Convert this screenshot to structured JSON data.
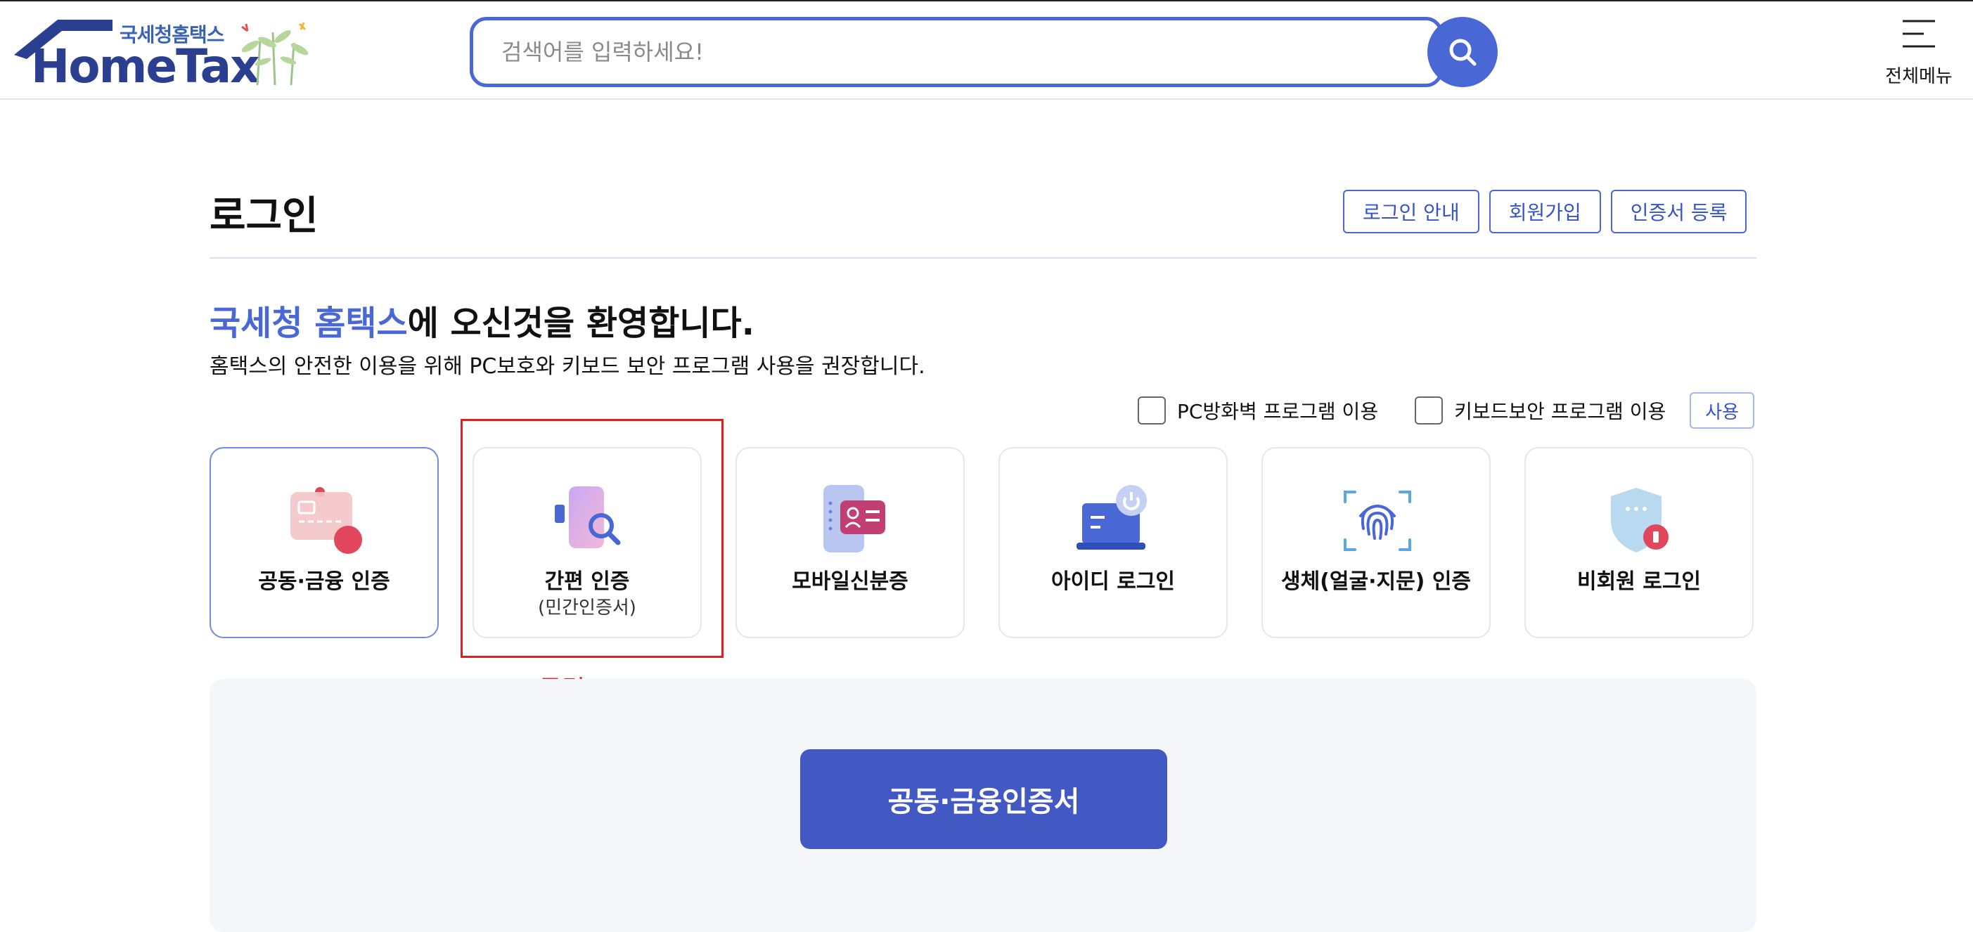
{
  "header": {
    "logo": {
      "subtitle": "국세청홈택스",
      "title": "HomeTax"
    },
    "search": {
      "placeholder": "검색어를 입력하세요!"
    },
    "menu_label": "전체메뉴"
  },
  "login": {
    "title": "로그인",
    "top_links": [
      "로그인 안내",
      "회원가입",
      "인증서 등록"
    ],
    "welcome_highlight": "국세청 홈택스",
    "welcome_rest": "에 오신것을 환영합니다.",
    "notice": "홈택스의 안전한 이용을 위해 PC보호와 키보드 보안 프로그램 사용을 권장합니다.",
    "options": {
      "firewall_label": "PC방화벽 프로그램 이용",
      "keyboard_label": "키보드보안 프로그램 이용",
      "use_button": "사용"
    },
    "methods": [
      {
        "label": "공동·금융 인증",
        "sub": "",
        "icon": "certificate-card-icon",
        "selected": true
      },
      {
        "label": "간편 인증",
        "sub": "(민간인증서)",
        "icon": "phone-search-icon",
        "selected": false
      },
      {
        "label": "모바일신분증",
        "sub": "",
        "icon": "mobile-id-icon",
        "selected": false
      },
      {
        "label": "아이디 로그인",
        "sub": "",
        "icon": "laptop-power-icon",
        "selected": false
      },
      {
        "label": "생체(얼굴·지문) 인증",
        "sub": "",
        "icon": "fingerprint-icon",
        "selected": false
      },
      {
        "label": "비회원 로그인",
        "sub": "",
        "icon": "shield-icon",
        "selected": false
      }
    ],
    "annotation": "클릭!",
    "primary_button": "공동·금융인증서"
  },
  "colors": {
    "brand_blue": "#4a67d6",
    "button_blue": "#4258c2",
    "annotation_red": "#e0201f"
  }
}
